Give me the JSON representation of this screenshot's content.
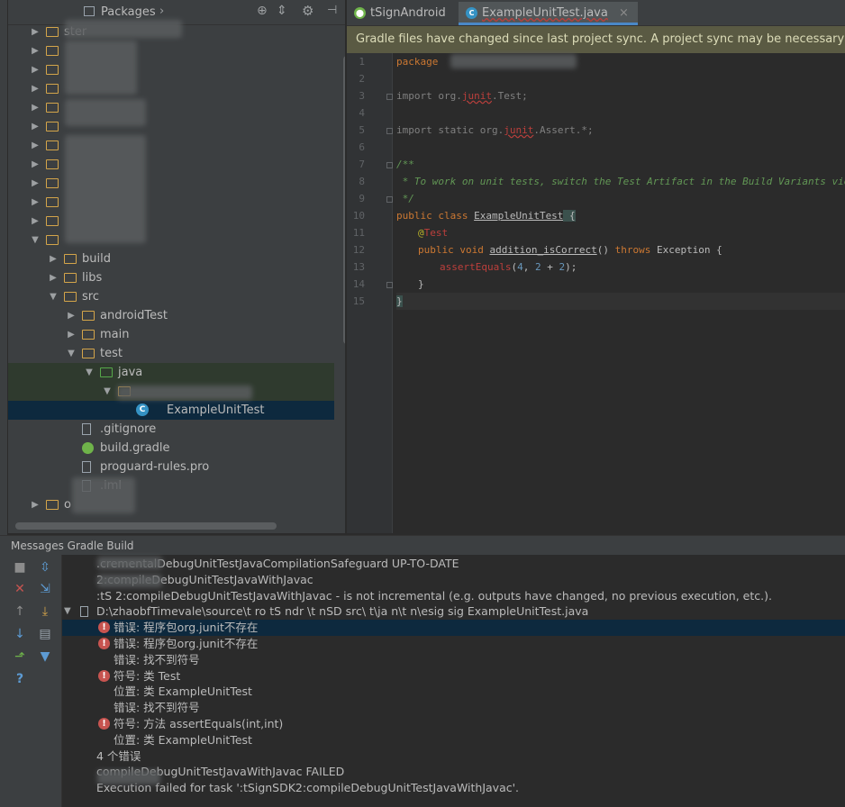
{
  "project_panel": {
    "view_label": "Packages",
    "tree": [
      {
        "label": "ster",
        "indent": 0,
        "arrow": "▶",
        "icon": "module"
      },
      {
        "label": "",
        "indent": 0,
        "arrow": "▶",
        "icon": "module"
      },
      {
        "label": "",
        "indent": 0,
        "arrow": "▶",
        "icon": "module"
      },
      {
        "label": "",
        "indent": 0,
        "arrow": "▶",
        "icon": "module"
      },
      {
        "label": "",
        "indent": 0,
        "arrow": "▶",
        "icon": "module"
      },
      {
        "label": "",
        "indent": 0,
        "arrow": "▶",
        "icon": "module"
      },
      {
        "label": "",
        "indent": 0,
        "arrow": "▶",
        "icon": "module"
      },
      {
        "label": "",
        "indent": 0,
        "arrow": "▶",
        "icon": "module"
      },
      {
        "label": "",
        "indent": 0,
        "arrow": "▶",
        "icon": "module"
      },
      {
        "label": "",
        "indent": 0,
        "arrow": "▶",
        "icon": "module"
      },
      {
        "label": "",
        "indent": 0,
        "arrow": "▶",
        "icon": "module"
      },
      {
        "label": "",
        "indent": 0,
        "arrow": "▼",
        "icon": "module"
      },
      {
        "label": "build",
        "indent": 1,
        "arrow": "▶",
        "icon": "folder"
      },
      {
        "label": "libs",
        "indent": 1,
        "arrow": "▶",
        "icon": "folder"
      },
      {
        "label": "src",
        "indent": 1,
        "arrow": "▼",
        "icon": "folder"
      },
      {
        "label": "androidTest",
        "indent": 2,
        "arrow": "▶",
        "icon": "folder"
      },
      {
        "label": "main",
        "indent": 2,
        "arrow": "▶",
        "icon": "folder"
      },
      {
        "label": "test",
        "indent": 2,
        "arrow": "▼",
        "icon": "folder"
      },
      {
        "label": "java",
        "indent": 3,
        "arrow": "▼",
        "icon": "folder-java"
      },
      {
        "label": "",
        "indent": 4,
        "arrow": "▼",
        "icon": "package"
      },
      {
        "label": "ExampleUnitTest",
        "indent": 5,
        "arrow": "",
        "icon": "class"
      },
      {
        "label": ".gitignore",
        "indent": 2,
        "arrow": "",
        "icon": "file"
      },
      {
        "label": "build.gradle",
        "indent": 2,
        "arrow": "",
        "icon": "gradle"
      },
      {
        "label": "proguard-rules.pro",
        "indent": 2,
        "arrow": "",
        "icon": "file"
      },
      {
        "label": ".iml",
        "indent": 2,
        "arrow": "",
        "icon": "file"
      },
      {
        "label": "o",
        "indent": 0,
        "arrow": "▶",
        "icon": "module"
      }
    ]
  },
  "editor": {
    "tabs": [
      {
        "label": "tSignAndroid",
        "active": false
      },
      {
        "label": "ExampleUnitTest.java",
        "active": true,
        "close": "×"
      }
    ],
    "banner": "Gradle files have changed since last project sync. A project sync may be necessary for the IDE",
    "code": {
      "l1": "package",
      "l3a": "import org.",
      "l3b": "junit",
      "l3c": ".Test;",
      "l5a": "import static org.",
      "l5b": "junit",
      "l5c": ".Assert.*;",
      "l7": "/**",
      "l8": " * To work on unit tests, switch the Test Artifact in the Build Variants view.",
      "l9": " */",
      "l10a": "public class ",
      "l10b": "ExampleUnitTest",
      "l10c": " {",
      "l11a": "@",
      "l11b": "Test",
      "l12a": "public void ",
      "l12b": "addition_isCorrect",
      "l12c": "() ",
      "l12d": "throws",
      "l12e": " Exception {",
      "l13a": "assertEquals",
      "l13b": "(",
      "l13c": "4",
      "l13d": ", ",
      "l13e": "2",
      "l13f": " + ",
      "l13g": "2",
      "l13h": ");",
      "l14": "}",
      "l15": "}"
    },
    "line_numbers": [
      "1",
      "2",
      "3",
      "4",
      "5",
      "6",
      "7",
      "8",
      "9",
      "10",
      "11",
      "12",
      "13",
      "14",
      "15"
    ]
  },
  "messages": {
    "header": "Messages Gradle Build",
    "rows": [
      {
        "text": ".crementalDebugUnitTestJavaCompilationSafeguard UP-TO-DATE",
        "error": false
      },
      {
        "text": "2:compileDebugUnitTestJavaWithJavac",
        "error": false
      },
      {
        "text": ":tS        2:compileDebugUnitTestJavaWithJavac - is not incremental (e.g. outputs have changed, no previous execution, etc.).",
        "error": false
      },
      {
        "text": "D:\\zhaobfTimevale\\source\\t          ro     tS        ndr      \\t    nSD       src\\    t\\ja       n\\t      n\\esig       sig         ExampleUnitTest.java",
        "error": false
      },
      {
        "text": "错误: 程序包org.junit不存在",
        "error": true
      },
      {
        "text": "错误: 程序包org.junit不存在",
        "error": true
      },
      {
        "text": "错误: 找不到符号",
        "error": false
      },
      {
        "text": "符号:   类 Test",
        "error": true
      },
      {
        "text": "位置: 类 ExampleUnitTest",
        "error": false
      },
      {
        "text": "错误: 找不到符号",
        "error": false
      },
      {
        "text": "符号:   方法 assertEquals(int,int)",
        "error": true
      },
      {
        "text": "位置: 类 ExampleUnitTest",
        "error": false
      },
      {
        "text": "4 个错误",
        "error": false
      },
      {
        "text": "compileDebugUnitTestJavaWithJavac FAILED",
        "error": false
      },
      {
        "text": "Execution failed for task ':tSignSDK2:compileDebugUnitTestJavaWithJavac'.",
        "error": false
      }
    ]
  },
  "colors": {
    "accent": "#4a88c7",
    "error": "#c75450",
    "banner": "#5a5a43"
  }
}
